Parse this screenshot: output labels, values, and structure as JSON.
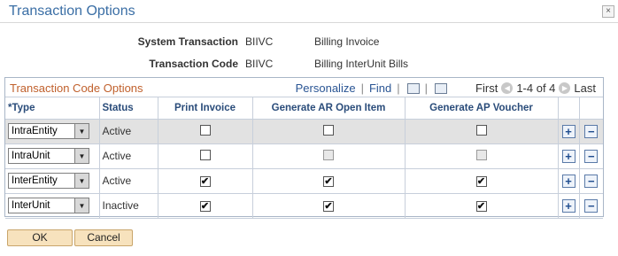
{
  "window": {
    "title": "Transaction Options",
    "close_glyph": "×"
  },
  "info": {
    "system_transaction_label": "System Transaction",
    "system_transaction_code": "BIIVC",
    "system_transaction_desc": "Billing Invoice",
    "transaction_code_label": "Transaction Code",
    "transaction_code_value": "BIIVC",
    "transaction_code_desc": "Billing InterUnit Bills"
  },
  "grid": {
    "title": "Transaction Code Options",
    "personalize": "Personalize",
    "find": "Find",
    "first": "First",
    "range": "1-4 of 4",
    "last": "Last",
    "prev_glyph": "◀",
    "next_glyph": "▶",
    "columns": [
      "*Type",
      "Status",
      "Print Invoice",
      "Generate AR Open Item",
      "Generate AP Voucher"
    ],
    "add_glyph": "+",
    "remove_glyph": "−",
    "rows": [
      {
        "type": "IntraEntity",
        "status": "Active",
        "print_invoice": "",
        "ar_open_item": "",
        "ap_voucher": ""
      },
      {
        "type": "IntraUnit",
        "status": "Active",
        "print_invoice": "",
        "ar_open_item": "",
        "ap_voucher": ""
      },
      {
        "type": "InterEntity",
        "status": "Active",
        "print_invoice": "✔",
        "ar_open_item": "✔",
        "ap_voucher": "✔"
      },
      {
        "type": "InterUnit",
        "status": "Inactive",
        "print_invoice": "✔",
        "ar_open_item": "✔",
        "ap_voucher": "✔"
      }
    ]
  },
  "buttons": {
    "ok": "OK",
    "cancel": "Cancel"
  }
}
